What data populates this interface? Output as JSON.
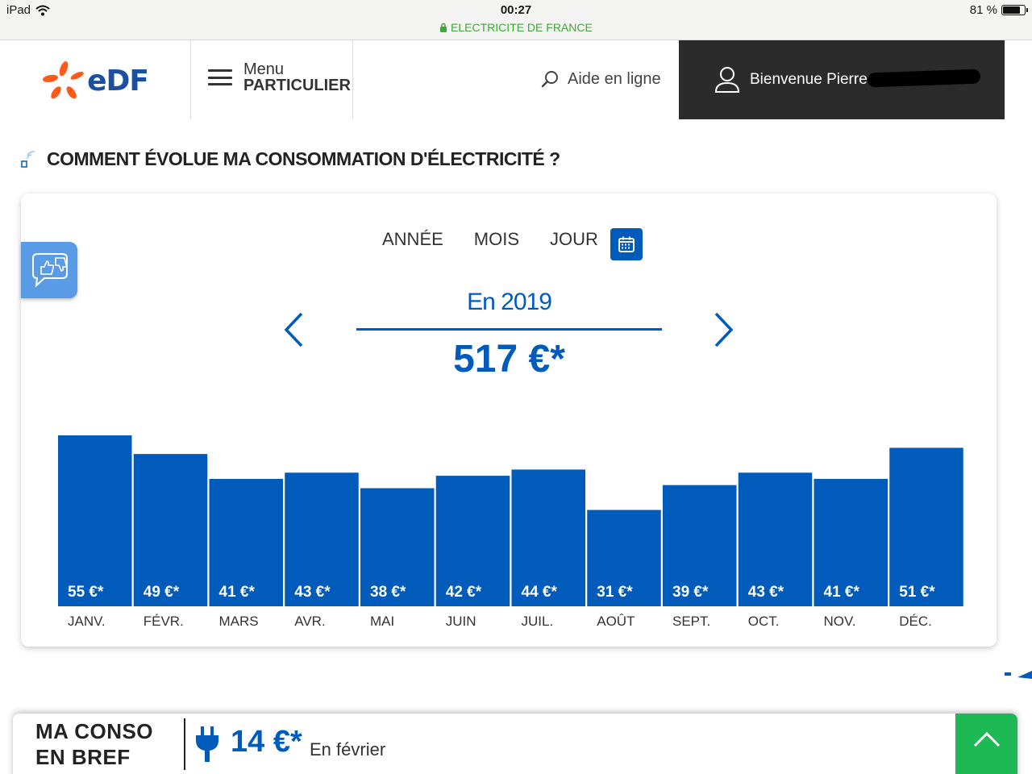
{
  "status_bar": {
    "device": "iPad",
    "time": "00:27",
    "site": "ELECTRICITE DE FRANCE",
    "battery": "81 %",
    "battery_level": 0.81
  },
  "header": {
    "logo_text": "eDF",
    "menu_line1": "Menu",
    "menu_line2": "PARTICULIER",
    "help_label": "Aide en ligne",
    "welcome": "Bienvenue Pierre"
  },
  "section": {
    "title": "COMMENT ÉVOLUE MA CONSOMMATION D'ÉLECTRICITÉ ?"
  },
  "tabs": [
    {
      "label": "ANNÉE",
      "active": true
    },
    {
      "label": "MOIS",
      "active": false
    },
    {
      "label": "JOUR",
      "active": false
    }
  ],
  "period": {
    "label": "En 2019",
    "total": "517 €*"
  },
  "chart_data": {
    "type": "bar",
    "categories": [
      "JANV.",
      "FÉVR.",
      "MARS",
      "AVR.",
      "MAI",
      "JUIN",
      "JUIL.",
      "AOÛT",
      "SEPT.",
      "OCT.",
      "NOV.",
      "DÉC."
    ],
    "values": [
      55,
      49,
      41,
      43,
      38,
      42,
      44,
      31,
      39,
      43,
      41,
      51
    ],
    "value_labels": [
      "55 €*",
      "49 €*",
      "41 €*",
      "43 €*",
      "38 €*",
      "42 €*",
      "44 €*",
      "31 €*",
      "39 €*",
      "43 €*",
      "41 €*",
      "51 €*"
    ],
    "title": "",
    "xlabel": "",
    "ylabel": "",
    "ylim": [
      0,
      55
    ],
    "grid": false,
    "bar_color": "#005bbb"
  },
  "bottom_bar": {
    "title_line1": "MA CONSO",
    "title_line2": "EN BREF",
    "value": "14 €*",
    "period": "En février"
  },
  "colors": {
    "brand_blue": "#005bbb",
    "edf_orange": "#ff5a1a",
    "edf_navy": "#1b4fa0",
    "secure_green": "#3aaa35",
    "up_button_green": "#1db954"
  }
}
